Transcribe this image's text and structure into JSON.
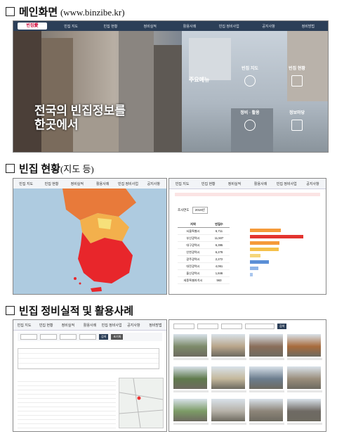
{
  "sections": {
    "main": {
      "title": "메인화면",
      "subtitle": "(www.binzibe.kr)"
    },
    "status": {
      "title": "빈집 현황",
      "subtitle": "(지도 등)"
    },
    "cases": {
      "title": "빈집 정비실적 및 활용사례"
    }
  },
  "hero": {
    "logo": "빈집愛",
    "nav": [
      "빈집 지도",
      "빈집 현황",
      "정비실적",
      "활용사례",
      "빈집 정비사업",
      "공지사항",
      "정비방법"
    ],
    "headline_line1": "전국의 빈집정보를",
    "headline_line2": "한곳에서",
    "menu_label": "주요메뉴",
    "tiles": [
      {
        "title": "빈집 지도",
        "color": "#3c6e8f"
      },
      {
        "title": "빈집 현황",
        "color": "#b5554a"
      },
      {
        "title": "정비 · 활용",
        "color": "#6a7d52"
      },
      {
        "title": "정보마당",
        "color": "#8e5b48"
      }
    ]
  },
  "map_panel": {
    "nav": [
      "빈집 지도",
      "빈집 현황",
      "정비실적",
      "활용사례",
      "빈집 정비사업",
      "공지사항"
    ]
  },
  "stats_panel": {
    "nav": [
      "빈집 지도",
      "빈집 현황",
      "정비실적",
      "활용사례",
      "빈집 정비사업",
      "공지사항"
    ],
    "filter_label": "조사연도",
    "filter_value": "2019년",
    "col_region": "지역",
    "col_count": "빈집수",
    "rows": [
      {
        "region": "서울특별시",
        "count": "6,711",
        "frac": 0.44
      },
      {
        "region": "부산광역시",
        "count": "11,507",
        "frac": 0.76
      },
      {
        "region": "대구광역시",
        "count": "6,395",
        "frac": 0.42
      },
      {
        "region": "인천광역시",
        "count": "6,278",
        "frac": 0.41
      },
      {
        "region": "광주광역시",
        "count": "2,272",
        "frac": 0.15
      },
      {
        "region": "대전광역시",
        "count": "4,061",
        "frac": 0.27
      },
      {
        "region": "울산광역시",
        "count": "1,846",
        "frac": 0.12
      },
      {
        "region": "세종특별자치시",
        "count": "563",
        "frac": 0.04
      }
    ],
    "bar_colors": [
      "#f59a3a",
      "#e3342f",
      "#f59a3a",
      "#f5c04a",
      "#f5d67a",
      "#5b8fd6",
      "#8db4e8",
      "#a9c6ee"
    ]
  },
  "records_panel": {
    "nav": [
      "빈집 지도",
      "빈집 현황",
      "정비실적",
      "활용사례",
      "빈집 정비사업",
      "공지사항",
      "정비방법"
    ],
    "search_label": "검색",
    "reset_label": "초기화"
  },
  "gallery_panel": {
    "search_label": "검색"
  }
}
